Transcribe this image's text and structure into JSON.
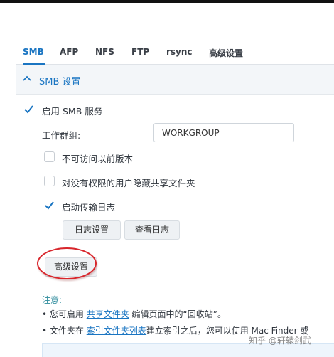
{
  "tabs": [
    {
      "label": "SMB",
      "active": true
    },
    {
      "label": "AFP"
    },
    {
      "label": "NFS"
    },
    {
      "label": "FTP"
    },
    {
      "label": "rsync"
    },
    {
      "label": "高级设置"
    }
  ],
  "section": {
    "title": "SMB 设置",
    "icon": "chevron-up-icon"
  },
  "smb": {
    "enable_label": "启用 SMB 服务",
    "enable_checked": true,
    "workgroup_label": "工作群组:",
    "workgroup_value": "WORKGROUP",
    "options": [
      {
        "label": "不可访问以前版本",
        "checked": false
      },
      {
        "label": "对没有权限的用户隐藏共享文件夹",
        "checked": false
      },
      {
        "label": "启动传输日志",
        "checked": true
      }
    ],
    "log_settings_button": "日志设置",
    "view_log_button": "查看日志",
    "advanced_button": "高级设置"
  },
  "note": {
    "title": "注意:",
    "line1_prefix": "• 您可启用 ",
    "line1_link": "共享文件夹",
    "line1_suffix": " 编辑页面中的“回收站”。",
    "line2_prefix": "• 文件夹在 ",
    "line2_link": "索引文件夹列表",
    "line2_suffix": "建立索引之后，您可以使用 Mac Finder 或"
  },
  "watermark": "知乎 @轩辕剑武",
  "colors": {
    "accent": "#1a75c2",
    "annotation": "#d8262c"
  }
}
